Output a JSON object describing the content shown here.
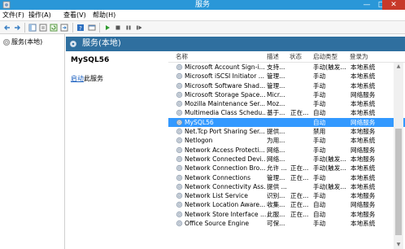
{
  "window": {
    "title": "服务",
    "minimize_glyph": "—",
    "maximize_glyph": "□",
    "close_glyph": "✕"
  },
  "menu": [
    "文件(F)",
    "操作(A)",
    "查看(V)",
    "帮助(H)"
  ],
  "toolbar_icons": [
    "back-arrow-icon",
    "forward-arrow-icon",
    "show-tree-icon",
    "properties-icon",
    "refresh-icon",
    "export-icon",
    "help-icon",
    "console-icon",
    "start-icon",
    "stop-icon",
    "pause-icon",
    "restart-icon"
  ],
  "tree": {
    "label": "服务(本地)"
  },
  "header": {
    "title": "服务(本地)"
  },
  "detail": {
    "service_name": "MySQL56",
    "start_link": "启动",
    "start_suffix": "此服务"
  },
  "columns": {
    "name": "名称",
    "desc": "描述",
    "status": "状态",
    "start_type": "启动类型",
    "logon": "登录为"
  },
  "rows": [
    {
      "name": "Microsoft Account Sign-i...",
      "desc": "支持...",
      "status": "",
      "start": "手动(触发...",
      "logon": "本地系统"
    },
    {
      "name": "Microsoft iSCSI Initiator ...",
      "desc": "管理...",
      "status": "",
      "start": "手动",
      "logon": "本地系统"
    },
    {
      "name": "Microsoft Software Shad...",
      "desc": "管理...",
      "status": "",
      "start": "手动",
      "logon": "本地系统"
    },
    {
      "name": "Microsoft Storage Space...",
      "desc": "Micr...",
      "status": "",
      "start": "手动",
      "logon": "网络服务"
    },
    {
      "name": "Mozilla Maintenance Ser...",
      "desc": "Moz...",
      "status": "",
      "start": "手动",
      "logon": "本地系统"
    },
    {
      "name": "Multimedia Class Schedu...",
      "desc": "基于...",
      "status": "正在...",
      "start": "自动",
      "logon": "本地系统"
    },
    {
      "name": "MySQL56",
      "desc": "",
      "status": "",
      "start": "自动",
      "logon": "网络服务",
      "selected": true
    },
    {
      "name": "Net.Tcp Port Sharing Ser...",
      "desc": "提供...",
      "status": "",
      "start": "禁用",
      "logon": "本地服务"
    },
    {
      "name": "Netlogon",
      "desc": "为用...",
      "status": "",
      "start": "手动",
      "logon": "本地系统"
    },
    {
      "name": "Network Access Protecti...",
      "desc": "网络...",
      "status": "",
      "start": "手动",
      "logon": "网络服务"
    },
    {
      "name": "Network Connected Devi...",
      "desc": "网络...",
      "status": "",
      "start": "手动(触发...",
      "logon": "本地服务"
    },
    {
      "name": "Network Connection Bro...",
      "desc": "允许 ...",
      "status": "正在...",
      "start": "手动(触发...",
      "logon": "本地系统"
    },
    {
      "name": "Network Connections",
      "desc": "管理...",
      "status": "正在...",
      "start": "手动",
      "logon": "本地系统"
    },
    {
      "name": "Network Connectivity Ass...",
      "desc": "提供 ...",
      "status": "",
      "start": "手动(触发...",
      "logon": "本地系统"
    },
    {
      "name": "Network List Service",
      "desc": "识别...",
      "status": "正在...",
      "start": "手动",
      "logon": "本地服务"
    },
    {
      "name": "Network Location Aware...",
      "desc": "收集...",
      "status": "正在...",
      "start": "自动",
      "logon": "网络服务"
    },
    {
      "name": "Network Store Interface ...",
      "desc": "此服...",
      "status": "正在...",
      "start": "自动",
      "logon": "本地服务"
    },
    {
      "name": "Office Source Engine",
      "desc": "可保...",
      "status": "",
      "start": "手动",
      "logon": "本地系统"
    }
  ]
}
